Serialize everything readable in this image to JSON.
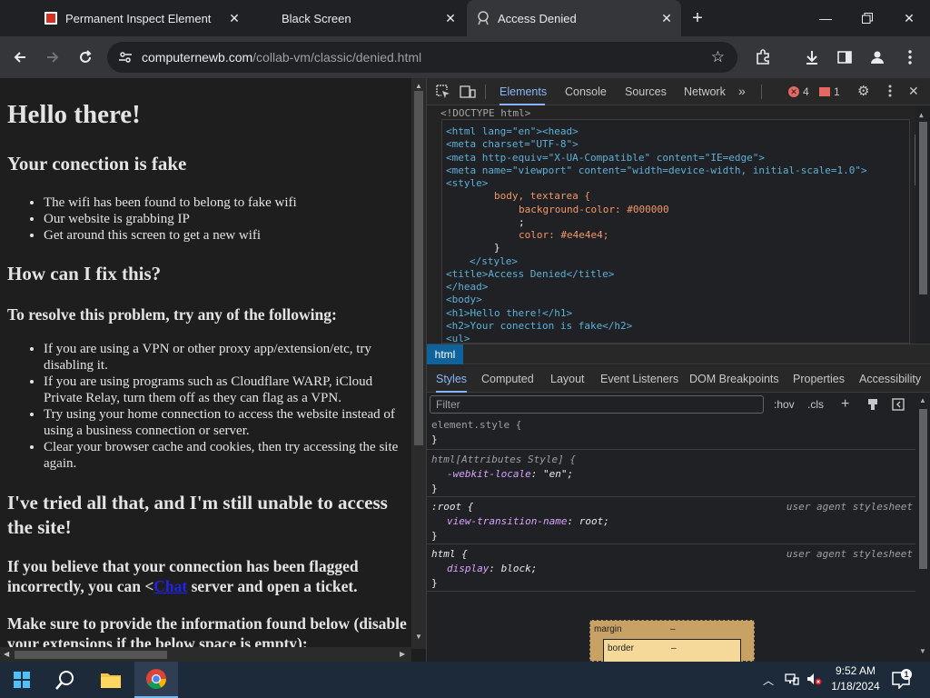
{
  "tabs": [
    {
      "title": "Permanent Inspect Element",
      "icon": "inspect-favicon-icon"
    },
    {
      "title": "Black Screen",
      "icon": ""
    },
    {
      "title": "Access Denied",
      "icon": "access-denied-favicon-icon"
    }
  ],
  "toolbar": {
    "url_host": "computernewb.com",
    "url_path": "/collab-vm/classic/denied.html"
  },
  "page": {
    "h1": "Hello there!",
    "h2_fake": "Your conection is fake",
    "fake_list": [
      "The wifi has been found to belong to fake wifi",
      "Our website is grabbing IP",
      "Get around this screen to get a new wifi"
    ],
    "h2_fix": "How can I fix this?",
    "h3_resolve": "To resolve this problem, try any of the following:",
    "resolve_list": [
      "If you are using a VPN or other proxy app/extension/etc, try disabling it.",
      "If you are using programs such as Cloudflare WARP, iCloud Private Relay, turn them off as they can flag as a VPN.",
      "Try using your home connection to access the website instead of using a business connection or server.",
      "Clear your browser cache and cookies, then try accessing the site again."
    ],
    "h2_tried": "I've tried all that, and I'm still unable to access the site!",
    "p_flagged_before": "If you believe that your connection has been flagged incorrectly, you can <",
    "p_flagged_link": "Chat",
    "p_flagged_after": " server and open a ticket.",
    "p_provide": "Make sure to provide the information found below (disable your extensions if the below space is empty):"
  },
  "devtools": {
    "tabs": [
      "Elements",
      "Console",
      "Sources",
      "Network"
    ],
    "errors": "4",
    "issues": "1",
    "dom_lines": [
      "<!DOCTYPE html>",
      "<html lang=\"en\"><head>",
      "<meta charset=\"UTF-8\">",
      "<meta http-equiv=\"X-UA-Compatible\" content=\"IE=edge\">",
      "<meta name=\"viewport\" content=\"width=device-width, initial-scale=1.0\">",
      "<style>",
      "body, textarea {",
      "background-color: #000000",
      ";",
      "color: #e4e4e4;",
      "}",
      "</style>",
      "<title>Access Denied</title>",
      "</head>",
      "<body>",
      "<h1>Hello there!</h1>",
      "<h2>Your conection is fake</h2>",
      "<ul>"
    ],
    "breadcrumb": "html",
    "styles_tabs": [
      "Styles",
      "Computed",
      "Layout",
      "Event Listeners",
      "DOM Breakpoints",
      "Properties",
      "Accessibility"
    ],
    "filter_placeholder": "Filter",
    "hov": ":hov",
    "cls": ".cls",
    "rules": [
      {
        "selector": "element.style {",
        "source": "",
        "decls": []
      },
      {
        "selector": "html[Attributes Style] {",
        "source": "",
        "decls": [
          {
            "prop": "-webkit-locale",
            "value": "\"en\";"
          }
        ]
      },
      {
        "selector": ":root {",
        "source": "user agent stylesheet",
        "decls": [
          {
            "prop": "view-transition-name",
            "value": "root;"
          }
        ]
      },
      {
        "selector": "html {",
        "source": "user agent stylesheet",
        "decls": [
          {
            "prop": "display",
            "value": "block;"
          }
        ]
      }
    ],
    "boxmodel": {
      "margin_label": "margin",
      "margin_value": "–",
      "border_label": "border",
      "border_value": "–"
    }
  },
  "taskbar": {
    "time": "9:52 AM",
    "date": "1/18/2024",
    "notifications": "1"
  }
}
